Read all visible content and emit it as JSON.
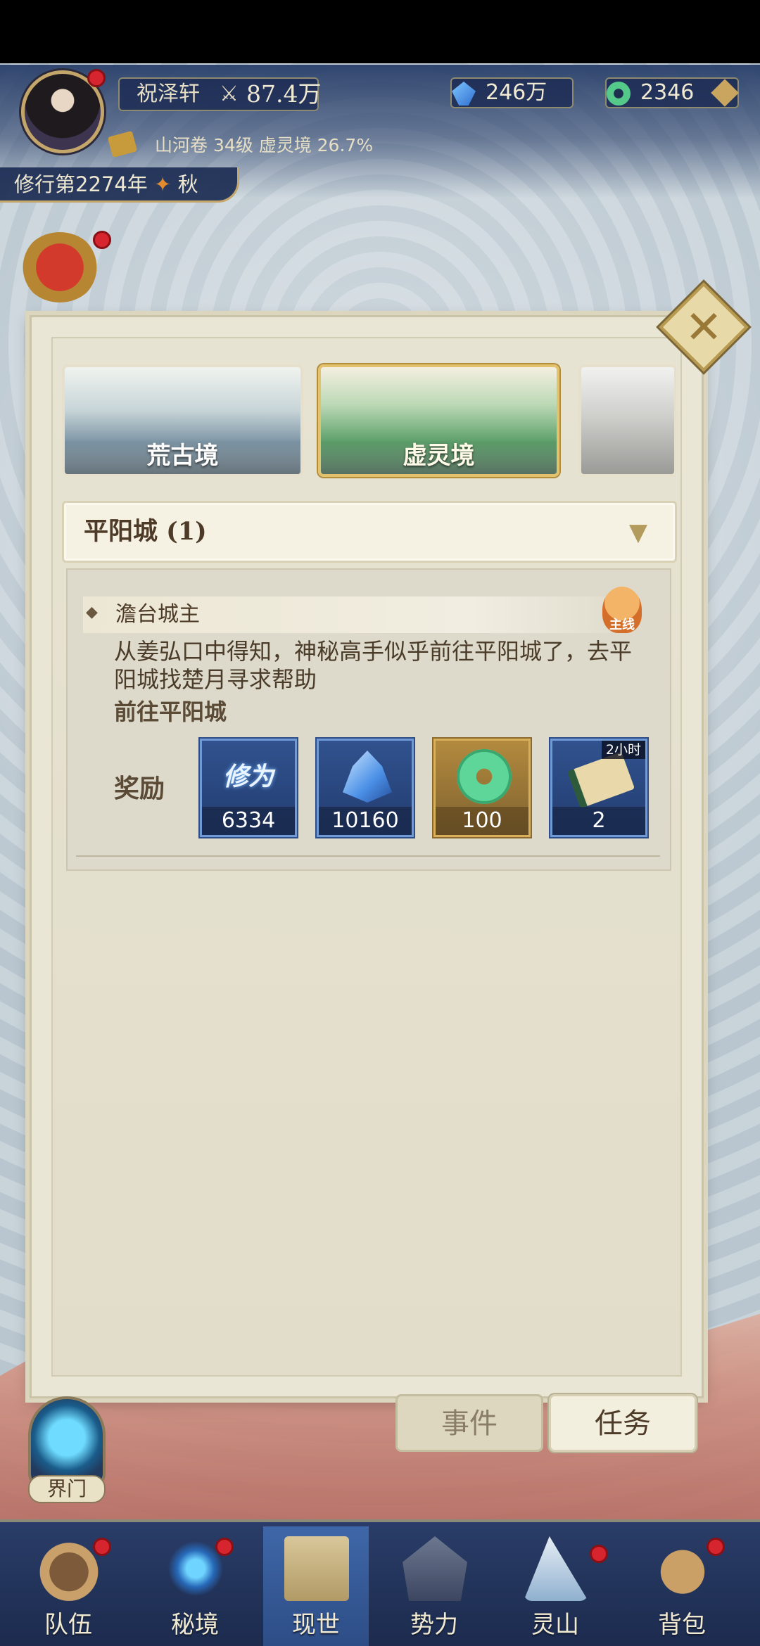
{
  "hud": {
    "player_name": "祝泽轩",
    "power": "87.4万",
    "spirit_stones": "246万",
    "jade": "2346",
    "info_line": "山河卷 34级 虚灵境 26.7%",
    "year_prefix": "修行第2274年",
    "season": "秋"
  },
  "realms": [
    {
      "label": "荒古境"
    },
    {
      "label": "虚灵境"
    }
  ],
  "city": {
    "name": "平阳城 (1)"
  },
  "quest": {
    "title": "澹台城主",
    "tag": "主线",
    "description": "从姜弘口中得知，神秘高手似乎前往平阳城了，去平阳城找楚月寻求帮助",
    "goal": "前往平阳城",
    "reward_label": "奖励",
    "rewards": [
      {
        "name": "修为",
        "count": "6334"
      },
      {
        "name": "",
        "count": "10160"
      },
      {
        "name": "",
        "count": "100"
      },
      {
        "name": "",
        "count": "2",
        "time": "2小时"
      }
    ]
  },
  "tabs": {
    "event": "事件",
    "task": "任务"
  },
  "portal": {
    "label": "界门"
  },
  "nav": [
    {
      "label": "队伍"
    },
    {
      "label": "秘境"
    },
    {
      "label": "现世"
    },
    {
      "label": "势力"
    },
    {
      "label": "灵山"
    },
    {
      "label": "背包"
    }
  ],
  "colors": {
    "accent_gold": "#c5a66a",
    "nav_bg": "#2a3d68",
    "panel_bg": "#eae6d6"
  }
}
